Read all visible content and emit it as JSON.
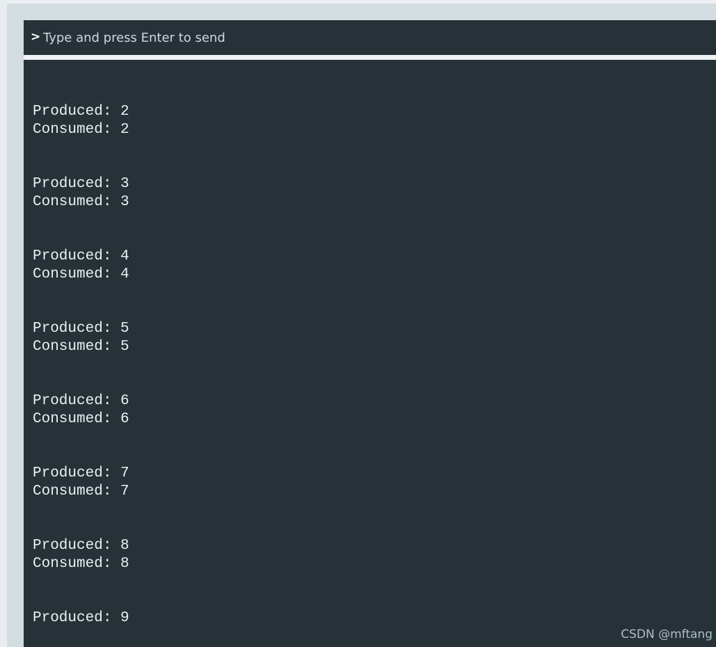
{
  "console": {
    "prompt_symbol": ">",
    "input_placeholder": "Type and press Enter to send",
    "input_value": "",
    "output_lines": [
      "Produced: 2",
      "Consumed: 2",
      "",
      "",
      "Produced: 3",
      "Consumed: 3",
      "",
      "",
      "Produced: 4",
      "Consumed: 4",
      "",
      "",
      "Produced: 5",
      "Consumed: 5",
      "",
      "",
      "Produced: 6",
      "Consumed: 6",
      "",
      "",
      "Produced: 7",
      "Consumed: 7",
      "",
      "",
      "Produced: 8",
      "Consumed: 8",
      "",
      "",
      "Produced: 9"
    ]
  },
  "watermark": "CSDN @mftang",
  "colors": {
    "console_background": "#263238",
    "console_text": "#eceff1",
    "frame": "#d3dce1"
  },
  "icons": {
    "prompt": "chevron-right-icon"
  }
}
